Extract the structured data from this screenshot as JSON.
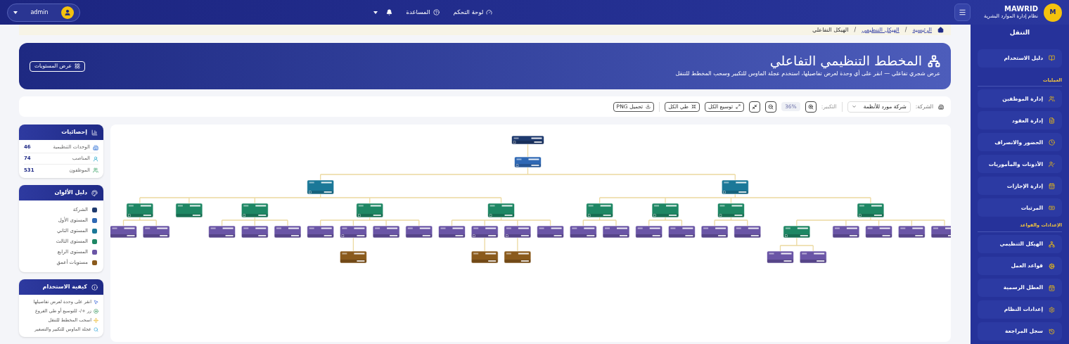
{
  "topbar": {
    "brand": "MAWRID",
    "brand_subtitle": "نظام إدارة الموارد البشرية",
    "logo_letter": "M",
    "nav": [
      "لوحة التحكم",
      "المساعدة"
    ],
    "user": "admin"
  },
  "sidebar": {
    "title": "التنقل",
    "sections": [
      {
        "items": [
          "دليل الاستخدام"
        ]
      },
      {
        "heading": "العمليات",
        "items": [
          "إدارة الموظفين",
          "إدارة العقود",
          "الحضور والانصراف",
          "الأذونات والمأموريات",
          "إدارة الإجازات",
          "المرتبات"
        ]
      },
      {
        "heading": "الإعدادات والقواعد",
        "items": [
          "الهيكل التنظيمي",
          "قواعد العمل",
          "العطل الرسمية",
          "إعدادات النظام",
          "سجل المراجعة"
        ]
      }
    ]
  },
  "breadcrumb": [
    {
      "label": "الرئيسية",
      "link": true
    },
    {
      "separator": "/",
      "label": "الهيكل التنظيمي",
      "link": true
    },
    {
      "separator": "/",
      "label": "الهيكل التفاعلي",
      "link": false
    }
  ],
  "banner": {
    "title": "المخطط التنظيمي التفاعلي",
    "subtitle": "عرض شجري تفاعلي — انقر على أي وحدة لعرض تفاصيلها، استخدم عجلة الماوس للتكبير وسحب المخطط للتنقل",
    "button": "عرض المستويات"
  },
  "toolbar": {
    "company_label": "الشركة:",
    "company_value": "شركة مورد للأنظمة",
    "zoom_label": "التكبير:",
    "zoom_value": "36%",
    "buttons": [
      "توسيع الكل",
      "طي الكل",
      "تحميل PNG"
    ]
  },
  "stats": {
    "title": "إحصائيات",
    "rows": [
      {
        "label": "الوحدات التنظيمية",
        "value": "46"
      },
      {
        "label": "المناصب",
        "value": "74"
      },
      {
        "label": "الموظفون",
        "value": "531"
      }
    ]
  },
  "legend": {
    "title": "دليل الألوان",
    "items": [
      {
        "label": "الشركة",
        "color": "#1e3a6e"
      },
      {
        "label": "المستوى الأول",
        "color": "#2f68b4"
      },
      {
        "label": "المستوى الثاني",
        "color": "#1b7898"
      },
      {
        "label": "المستوى الثالث",
        "color": "#1e8764"
      },
      {
        "label": "المستوى الرابع",
        "color": "#6a55a6"
      },
      {
        "label": "مستويات أعمق",
        "color": "#8a5a1c"
      }
    ]
  },
  "usage": {
    "title": "كيفية الاستخدام",
    "tips": [
      "انقر على وحدة لعرض تفاصيلها",
      "زر +/- للتوسيع أو طي الفروع",
      "اسحب المخطط للتنقل",
      "عجلة الماوس للتكبير والتصغير"
    ]
  },
  "org_chart": {
    "root": {
      "kind": "company",
      "children": [
        {
          "kind": "level1",
          "children": [
            {
              "kind": "level2",
              "children": [
                {
                  "kind": "level3",
                  "children": [
                    {
                      "kind": "level4"
                    },
                    {
                      "kind": "level4"
                    },
                    {
                      "kind": "level4"
                    },
                    {
                      "kind": "level4"
                    },
                    {
                      "kind": "level3",
                      "children": [
                        {
                          "kind": "level4"
                        },
                        {
                          "kind": "level4"
                        }
                      ]
                    }
                  ]
                },
                {
                  "kind": "level3",
                  "children": [
                    {
                      "kind": "level4"
                    },
                    {
                      "kind": "level4"
                    }
                  ]
                },
                {
                  "kind": "level3",
                  "children": [
                    {
                      "kind": "level4"
                    },
                    {
                      "kind": "level4"
                    }
                  ]
                },
                {
                  "kind": "level3",
                  "children": [
                    {
                      "kind": "level4"
                    },
                    {
                      "kind": "level4"
                    }
                  ]
                }
              ]
            },
            {
              "kind": "level2",
              "children": [
                {
                  "kind": "level3",
                  "children": [
                    {
                      "kind": "level4"
                    },
                    {
                      "kind": "level4",
                      "children": [
                        {
                          "kind": "deeper"
                        }
                      ]
                    },
                    {
                      "kind": "level4",
                      "children": [
                        {
                          "kind": "deeper"
                        }
                      ]
                    },
                    {
                      "kind": "level4"
                    }
                  ]
                },
                {
                  "kind": "level3",
                  "children": [
                    {
                      "kind": "level4"
                    },
                    {
                      "kind": "level4"
                    },
                    {
                      "kind": "level4",
                      "children": [
                        {
                          "kind": "deeper"
                        }
                      ]
                    },
                    {
                      "kind": "level4"
                    }
                  ]
                },
                {
                  "kind": "level3",
                  "children": [
                    {
                      "kind": "level4"
                    },
                    {
                      "kind": "level4"
                    },
                    {
                      "kind": "level4"
                    }
                  ]
                },
                {
                  "kind": "level3"
                },
                {
                  "kind": "level3",
                  "children": [
                    {
                      "kind": "level4"
                    },
                    {
                      "kind": "level4"
                    }
                  ]
                }
              ]
            }
          ]
        }
      ]
    }
  }
}
